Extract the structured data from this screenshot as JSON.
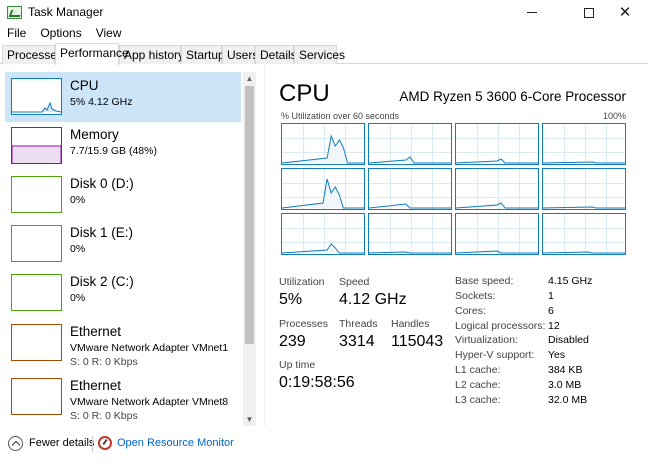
{
  "window": {
    "title": "Task Manager",
    "icon": "task-manager-icon"
  },
  "menu": [
    "File",
    "Options",
    "View"
  ],
  "tabs": [
    "Processes",
    "Performance",
    "App history",
    "Startup",
    "Users",
    "Details",
    "Services"
  ],
  "active_tab": "Performance",
  "perf_list": [
    {
      "name": "CPU",
      "sub": "5% 4.12 GHz",
      "sub2": "",
      "color": "#117dbb"
    },
    {
      "name": "Memory",
      "sub": "7.7/15.9 GB (48%)",
      "sub2": "",
      "color": "#8b12ae"
    },
    {
      "name": "Disk 0 (D:)",
      "sub": "0%",
      "sub2": "",
      "color": "#4da60c"
    },
    {
      "name": "Disk 1 (E:)",
      "sub": "0%",
      "sub2": "",
      "color": "#4da60c"
    },
    {
      "name": "Disk 2 (C:)",
      "sub": "0%",
      "sub2": "",
      "color": "#4da60c"
    },
    {
      "name": "Ethernet",
      "sub": "VMware Network Adapter VMnet1",
      "sub2": "S: 0 R: 0 Kbps",
      "color": "#a74f01"
    },
    {
      "name": "Ethernet",
      "sub": "VMware Network Adapter VMnet8",
      "sub2": "S: 0 R: 0 Kbps",
      "color": "#a74f01"
    }
  ],
  "cpu": {
    "title": "CPU",
    "processor": "AMD Ryzen 5 3600 6-Core Processor",
    "graph_label": "% Utilization over 60 seconds",
    "graph_max": "100%",
    "stats": {
      "utilization_label": "Utilization",
      "utilization": "5%",
      "speed_label": "Speed",
      "speed": "4.12 GHz",
      "processes_label": "Processes",
      "processes": "239",
      "threads_label": "Threads",
      "threads": "3314",
      "handles_label": "Handles",
      "handles": "115043",
      "uptime_label": "Up time",
      "uptime": "0:19:58:56"
    },
    "specs": [
      {
        "label": "Base speed:",
        "value": "4.15 GHz"
      },
      {
        "label": "Sockets:",
        "value": "1"
      },
      {
        "label": "Cores:",
        "value": "6"
      },
      {
        "label": "Logical processors:",
        "value": "12"
      },
      {
        "label": "Virtualization:",
        "value": "Disabled"
      },
      {
        "label": "Hyper-V support:",
        "value": "Yes"
      },
      {
        "label": "L1 cache:",
        "value": "384 KB"
      },
      {
        "label": "L2 cache:",
        "value": "3.0 MB"
      },
      {
        "label": "L3 cache:",
        "value": "32.0 MB"
      }
    ]
  },
  "footer": {
    "fewer_details": "Fewer details",
    "open_resource_monitor": "Open Resource Monitor"
  }
}
